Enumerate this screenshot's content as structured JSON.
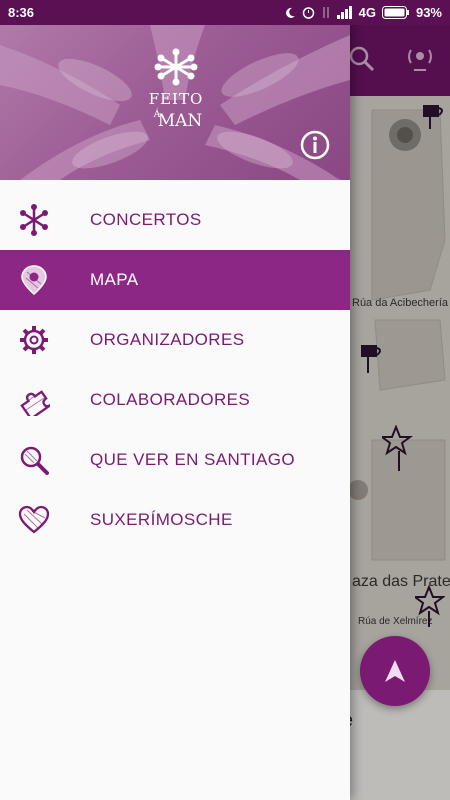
{
  "status_bar": {
    "time": "8:36",
    "network": "4G",
    "battery": "93%"
  },
  "colors": {
    "brand_purple": "#8d2785",
    "dark_purple": "#6e1466",
    "menu_text": "#7a1a73"
  },
  "header": {
    "logo_text_line1": "FEITO",
    "logo_text_line2": "Á",
    "logo_text_line3": "MAN",
    "info_icon": "info-circle-icon"
  },
  "menu": {
    "items": [
      {
        "label": "CONCERTOS",
        "icon": "asterisk-icon",
        "active": false
      },
      {
        "label": "MAPA",
        "icon": "map-pin-icon",
        "active": true
      },
      {
        "label": "ORGANIZADORES",
        "icon": "gear-icon",
        "active": false
      },
      {
        "label": "COLABORADORES",
        "icon": "puzzle-icon",
        "active": false
      },
      {
        "label": "QUE VER EN SANTIAGO",
        "icon": "magnifier-icon",
        "active": false
      },
      {
        "label": "SUXERÍMOSCHE",
        "icon": "heart-icon",
        "active": false
      }
    ]
  },
  "map": {
    "street_1": "Rúa da Acibechería",
    "street_2": "Praza das Praterías",
    "street_3": "Rúa de Xelmírez"
  }
}
